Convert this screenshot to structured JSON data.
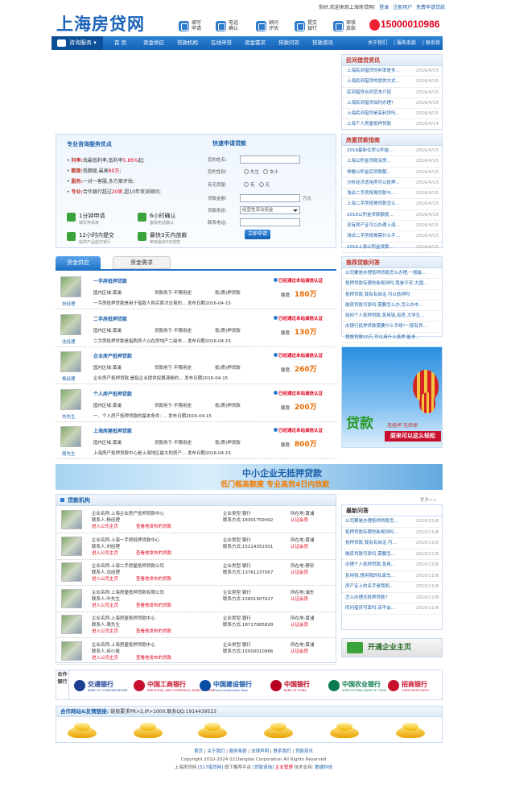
{
  "top": {
    "welcome": "你好,欢迎来到上海房贷网!",
    "login": "登录",
    "register": "注册用户",
    "free_apply": "免费申请贷款"
  },
  "logo": "上海房贷网",
  "quick": [
    {
      "l1": "填写",
      "l2": "申请",
      "icon": "form-icon"
    },
    {
      "l1": "电话",
      "l2": "确认",
      "icon": "phone-icon"
    },
    {
      "l1": "顾问",
      "l2": "评估",
      "icon": "consultant-icon"
    },
    {
      "l1": "提交",
      "l2": "银行",
      "icon": "bank-icon"
    },
    {
      "l1": "审核",
      "l2": "放款",
      "icon": "approve-icon"
    }
  ],
  "phone": "15000010986",
  "nav": {
    "first": "咨询服务",
    "items": [
      "首 页",
      "资金供应",
      "贷款机构",
      "在线申贷",
      "资金需求",
      "贷款问答",
      "贷款资讯"
    ],
    "right": [
      "关于我们",
      "服务条款",
      "联系我们"
    ]
  },
  "private_loan": {
    "title": "民间借贷资讯",
    "items": [
      {
        "t": "上海民间借贷的利率是多...",
        "d": "2016/4/15"
      },
      {
        "t": "上海民间借贷的提供方式...",
        "d": "2016/4/15"
      },
      {
        "t": "民间借贷合同范本介绍",
        "d": "2016/4/15"
      },
      {
        "t": "上海民间借贷如何办理?",
        "d": "2016/4/15"
      },
      {
        "t": "上海民间借贷是高利贷吗...",
        "d": "2016/4/15"
      },
      {
        "t": "上海个人房屋抵押贷款",
        "d": "2016/4/14"
      }
    ]
  },
  "consult": {
    "title": "专业咨询服务优点",
    "lines": [
      {
        "k": "利率:",
        "v": "找最低利率,低利率",
        "x": "5.85%",
        "v2": "起;"
      },
      {
        "k": "额度:",
        "v": "低额度,最高",
        "x": "80万",
        "v2": ";"
      },
      {
        "k": "服务:",
        "v": "一对一客服,多方案评估;",
        "x": "",
        "v2": ""
      },
      {
        "k": "专业:",
        "v": "合作银行超过",
        "x": "20家",
        "v2": ",超10年资深顾问;"
      }
    ],
    "features": [
      {
        "a": "1分钟申请",
        "b": "填写申请表"
      },
      {
        "a": "6小时确认",
        "b": "客服电话确认"
      },
      {
        "a": "12小时内提交",
        "b": "提供产品提交银行"
      },
      {
        "a": "最快3天内放款",
        "b": "审核最快3天放款"
      }
    ]
  },
  "form": {
    "title": "快速申请贷款",
    "name_label": "您的姓名:",
    "gender_label": "您的性别:",
    "gender_options": [
      "先生",
      "女士"
    ],
    "house_label": "有无房屋:",
    "house_options": [
      "有",
      "无"
    ],
    "amount_label": "贷款金额:",
    "amount_unit": "万元",
    "use_label": "贷款用途:",
    "use_value": "经营性流动资金",
    "phone_label": "联系电话:",
    "submit": "立即申请"
  },
  "tabs": [
    "资金供应",
    "资金需求"
  ],
  "loans": [
    {
      "title": "一手房抵押贷款",
      "who": "刘经理",
      "region": "国内区域:黄浦",
      "use": "贷款用于:不限用途",
      "type": "抵(质)押贷款",
      "amount_label": "额度:",
      "amount": "180万",
      "desc": "一手房抵押贷款是用于借款人购买首次交易的...  发布日期2016-04-15"
    },
    {
      "title": "二手房抵押贷款",
      "who": "沈经理",
      "region": "国内区域:黄浦",
      "use": "贷款用于:不限用途",
      "type": "抵(质)押贷款",
      "amount_label": "额度:",
      "amount": "130万",
      "desc": "二手房抵押贷款是指购房人以在房地产二级市...  发布日期2016-04-15"
    },
    {
      "title": "企业房产抵押贷款",
      "who": "杨经理",
      "region": "国内区域:黄浦",
      "use": "贷款用于:不限用途",
      "type": "抵(质)押贷款",
      "amount_label": "额度:",
      "amount": "260万",
      "desc": "企业房产抵押贷款,是指企业提供权属清晰的...  发布日期2016-04-15"
    },
    {
      "title": "个人房产抵押贷款",
      "who": "刘先生",
      "region": "国内区域:黄浦",
      "use": "贷款用于:不限用途",
      "type": "抵(质)押贷款",
      "amount_label": "额度:",
      "amount": "200万",
      "desc": "一、个人房产抵押贷款的基本条件:  ...  发布日期2016-04-15"
    },
    {
      "title": "上海房屋抵押贷款",
      "who": "周先生",
      "region": "国内区域:黄浦",
      "use": "贷款用于:不限用途",
      "type": "抵(质)押贷款",
      "amount_label": "额度:",
      "amount": "800万",
      "desc": "上海房产抵押贷款中心是上海地区最大的房产...  发布日期2016-04-15"
    }
  ],
  "cert_text": "已经通过本站诚信认证",
  "loan_guide": {
    "title": "房屋贷款指南",
    "items": [
      {
        "t": "2016最新住房公积金...",
        "d": "2016/4/15"
      },
      {
        "t": "上海公积金贷款买房...",
        "d": "2016/4/15"
      },
      {
        "t": "停缴公积金后贷款额...",
        "d": "2016/4/15"
      },
      {
        "t": "分析经济适用房可以抵押...",
        "d": "2016/4/15"
      },
      {
        "t": "浅谈二手房按揭贷款与...",
        "d": "2016/4/15"
      },
      {
        "t": "上海二手房按揭贷款怎么...",
        "d": "2016/4/15"
      },
      {
        "t": "2016公积金贷款额度...",
        "d": "2016/4/15"
      },
      {
        "t": "没有房产证可以办理上海...",
        "d": "2016/4/15"
      },
      {
        "t": "浅谈二手房按揭需什么手...",
        "d": "2016/4/15"
      },
      {
        "t": "2016上海公积金贷款...",
        "d": "2016/4/15"
      }
    ]
  },
  "recommend": {
    "title": "推荐贷款问答",
    "items": [
      "公司要是办理抵押贷款怎么办理,一般能...",
      "抵押贷款有哪些新规则吗,我是平安,大国...",
      "抵押贷款,我有有自证,可以抵押吗",
      "融资贷款可靠吗,需要怎么办,怎么办中...",
      "如何个人抵押贷款,急用钱,有房,大学生...",
      "办银行抵押贷款需要什么手续?一般有贷...",
      "我想贷款10万,可以用什么抵押,能多..."
    ]
  },
  "balloon_ad": {
    "big": "贷款",
    "s1": "无抵押 无担保",
    "s2": "原来可以这么轻松"
  },
  "wide_ad": {
    "a": "中小企业无抵押贷款",
    "b": "低门槛高额度 专业高效4日内放款"
  },
  "institutions": {
    "title": "贷款机构",
    "more": "更多>>",
    "items": [
      {
        "name": "企业名称:上海企业房产抵押贷款中心",
        "contact": "联系人:杨经理",
        "type": "企业类型:银行",
        "tel": "联系方式:18301759492",
        "area": "所在地:黄浦",
        "cert": "认证会员"
      },
      {
        "name": "企业名称:上海一手房抵押贷款中心",
        "contact": "联系人:刘经理",
        "type": "企业类型:银行",
        "tel": "联系方式:15214352301",
        "area": "所在地:黄浦",
        "cert": "认证会员"
      },
      {
        "name": "企业名称:上海二手房屋抵押贷款公司",
        "contact": "联系人:沈经理",
        "type": "企业类型:银行",
        "tel": "联系方式:13761237067",
        "area": "所在地:静安",
        "cert": "认证会员"
      },
      {
        "name": "企业名称:上海房屋抵押贷款有限公司",
        "contact": "联系人:叶先生",
        "type": "企业类型:银行",
        "tel": "联系方式:15801907027",
        "area": "所在地:浦东",
        "cert": "认证会员"
      },
      {
        "name": "企业名称:上海房屋抵押贷款中心",
        "contact": "联系人:周先生",
        "type": "企业类型:银行",
        "tel": "联系方式:18717885828",
        "area": "所在地:黄浦",
        "cert": "认证会员"
      },
      {
        "name": "企业名称:上海房屋抵押贷款中心",
        "contact": "联系人:邱小姐",
        "type": "企业类型:银行",
        "tel": "联系方式:15000010986",
        "area": "所在地:黄浦",
        "cert": "认证会员"
      }
    ],
    "enter": "进入公司主页",
    "send": "查看他发布的贷款"
  },
  "latest_qa": {
    "title": "最新问答",
    "items": [
      {
        "t": "公司要是办理抵押贷款怎...",
        "d": "2010/11/8"
      },
      {
        "t": "抵押贷款有哪些新规则吗...",
        "d": "2010/11/8"
      },
      {
        "t": "抵押贷款,我有有自证,可...",
        "d": "2010/11/8"
      },
      {
        "t": "融资贷款可靠吗,需要怎...",
        "d": "2010/11/8"
      },
      {
        "t": "办理个人抵押贷款,急用...",
        "d": "2010/11/8"
      },
      {
        "t": "急用钱,想用我的私家车...",
        "d": "2010/11/8"
      },
      {
        "t": "房产证上的名字是我和...",
        "d": "2010/11/8"
      },
      {
        "t": "怎么办理无抵押贷款?",
        "d": "2010/11/8"
      },
      {
        "t": "同问借贷可靠吗,该不会...",
        "d": "2010/11/8"
      }
    ]
  },
  "open_biz": "开通企业主页",
  "banks_label": "合作银行",
  "banks": [
    {
      "cn": "交通银行",
      "en": "BANK OF COMMUNICATIONS",
      "color": "#1c3f94"
    },
    {
      "cn": "中国工商银行",
      "en": "INDUSTRIAL AND COMMERCIAL BANK OF CHINA",
      "color": "#c8102e"
    },
    {
      "cn": "中国建设银行",
      "en": "China Construction Bank",
      "color": "#0a4ea3"
    },
    {
      "cn": "中国银行",
      "en": "BANK OF CHINA",
      "color": "#b8001f"
    },
    {
      "cn": "中国农业银行",
      "en": "AGRICULTURAL BANK OF CHINA",
      "color": "#0a7a4d"
    },
    {
      "cn": "招商银行",
      "en": "CHINA MERCHANTS",
      "color": "#c8102e"
    }
  ],
  "partners": {
    "title": "合作网站&友情链接:",
    "note": "链接要求PR>2,IP>1000,联系QQ:1914439523"
  },
  "footer": {
    "links": [
      "首页",
      "关于我们",
      "服务条款",
      "法律声明",
      "联系我们",
      "贷款资讯"
    ],
    "copyright": "Copyright 2010-2024 021fangdai Corporation All Rights Reserved",
    "line3a": "上海房贷网",
    "line3b": "[517猎贷网]",
    "line3c": "旗下推荐平台",
    "line3d": "[贷款咨询]",
    "line3e": "企业管理",
    "line3f": "技术支持:",
    "line3g": "数据科技"
  }
}
